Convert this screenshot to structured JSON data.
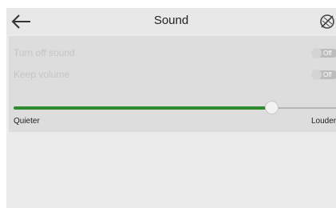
{
  "header": {
    "title": "Sound",
    "back_icon": "back-arrow-icon",
    "right_icon": "no-sound-icon"
  },
  "settings": [
    {
      "label": "Turn off sound",
      "toggle_text": "Off",
      "state": "off",
      "enabled": false
    },
    {
      "label": "Keep volume",
      "toggle_text": "Off",
      "state": "off",
      "enabled": false
    }
  ],
  "volume": {
    "min_label": "Quieter",
    "max_label": "Louder",
    "level": 0.8,
    "fill_color": "#2e8b2e"
  }
}
